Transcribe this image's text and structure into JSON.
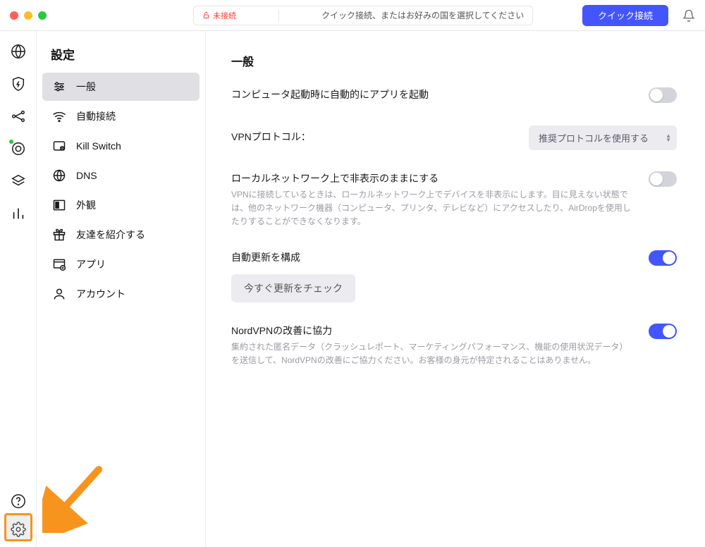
{
  "titlebar": {
    "status_label": "未接続",
    "status_hint": "クイック接続、またはお好みの国を選択してください",
    "quick_connect": "クイック接続"
  },
  "settings": {
    "title": "設定",
    "items": [
      {
        "label": "一般"
      },
      {
        "label": "自動接続"
      },
      {
        "label": "Kill Switch"
      },
      {
        "label": "DNS"
      },
      {
        "label": "外観"
      },
      {
        "label": "友達を紹介する"
      },
      {
        "label": "アプリ"
      },
      {
        "label": "アカウント"
      }
    ]
  },
  "content": {
    "heading": "一般",
    "launch_label": "コンピュータ起動時に自動的にアプリを起動",
    "protocol_label": "VPNプロトコル：",
    "protocol_value": "推奨プロトコルを使用する",
    "local_label": "ローカルネットワーク上で非表示のままにする",
    "local_desc": "VPNに接続しているときは、ローカルネットワーク上でデバイスを非表示にします。目に見えない状態では、他のネットワーク機器（コンピュータ、プリンタ、テレビなど）にアクセスしたり、AirDropを使用したりすることができなくなります。",
    "update_label": "自動更新を構成",
    "update_button": "今すぐ更新をチェック",
    "improve_label": "NordVPNの改善に協力",
    "improve_desc": "集約された匿名データ（クラッシュレポート、マーケティングパフォーマンス、機能の使用状況データ）を送信して、NordVPNの改善にご協力ください。お客様の身元が特定されることはありません。"
  }
}
